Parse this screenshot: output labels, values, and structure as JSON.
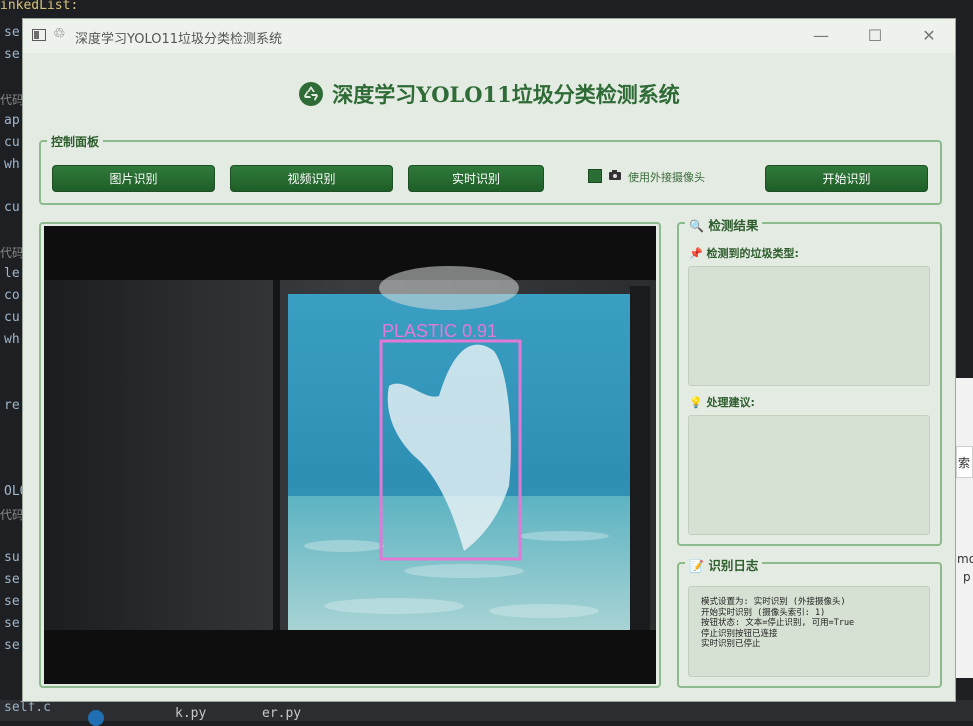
{
  "background_editor": {
    "top_text": "inkedList:",
    "line_prefixes": [
      "se",
      "se",
      "代码",
      "ap",
      "cu",
      "wh",
      "cu",
      "代码",
      "le",
      "co",
      "cu",
      "wh",
      "re",
      "OLO",
      "代码",
      "su",
      "se",
      "se",
      "se",
      "se"
    ],
    "bottom_left": "self.c",
    "bottom_files": [
      "k.py",
      "er.py"
    ],
    "right_peek": [
      "索",
      "mo",
      "p"
    ]
  },
  "window": {
    "title": "深度学习YOLO11垃圾分类检测系统",
    "controls": {
      "minimize": "—",
      "maximize": "☐",
      "close": "✕"
    }
  },
  "header": {
    "title": "深度学习YOLO11垃圾分类检测系统",
    "icon": "recycle-icon"
  },
  "control_panel": {
    "title": "控制面板",
    "buttons": {
      "image": "图片识别",
      "video": "视频识别",
      "realtime": "实时识别",
      "start": "开始识别"
    },
    "external_camera": {
      "label": "使用外接摄像头",
      "checked": true
    }
  },
  "detection": {
    "box_label": "PLASTIC 0.91",
    "class": "PLASTIC",
    "confidence": 0.91
  },
  "results_panel": {
    "title": "检测结果",
    "type_label": "检测到的垃圾类型:",
    "type_value": "",
    "advice_label": "处理建议:",
    "advice_value": ""
  },
  "log_panel": {
    "title": "识别日志",
    "lines": "模式设置为: 实时识别 (外接摄像头)\n开始实时识别 (摄像头索引: 1)\n按钮状态: 文本=停止识别, 可用=True\n停止识别按钮已连接\n实时识别已停止"
  },
  "colors": {
    "accent": "#2e6b36",
    "button": "#24682f",
    "detection_box": "#e279d6",
    "panel_bg": "#e4ebe2"
  }
}
